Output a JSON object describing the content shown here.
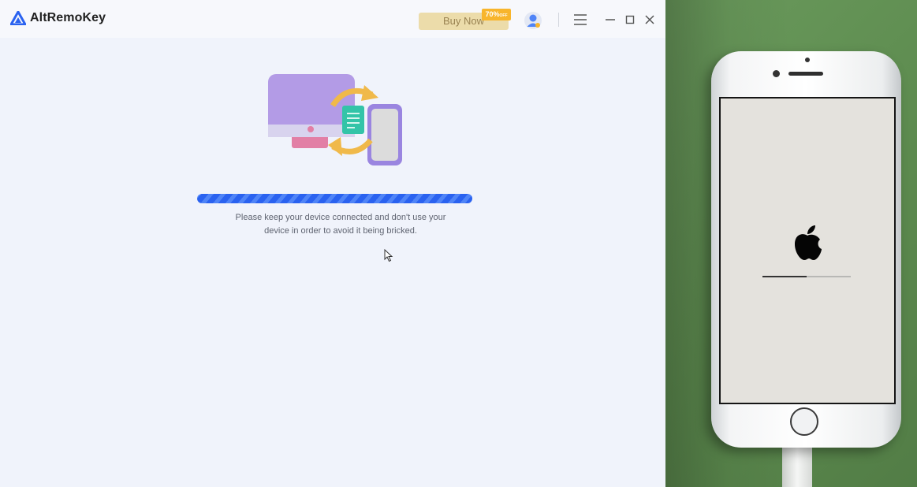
{
  "app": {
    "name": "AltRemoKey",
    "buy_label": "Buy Now",
    "discount_value": "70%",
    "discount_suffix": "OFF",
    "progress_percent": 100,
    "message_line1": "Please keep your device connected and don't use your",
    "message_line2": "device in order to avoid it being bricked.",
    "accent_color": "#2a62f0",
    "icons": [
      "logo-icon",
      "user-avatar-icon",
      "menu-icon",
      "minimize-icon",
      "maximize-icon",
      "close-icon",
      "computer-phone-transfer-illustration",
      "mouse-cursor-icon"
    ]
  },
  "photo": {
    "subject": "iphone-showing-apple-boot-screen",
    "boot_progress_fraction": 0.5,
    "icons": [
      "apple-logo-icon",
      "home-button"
    ]
  }
}
